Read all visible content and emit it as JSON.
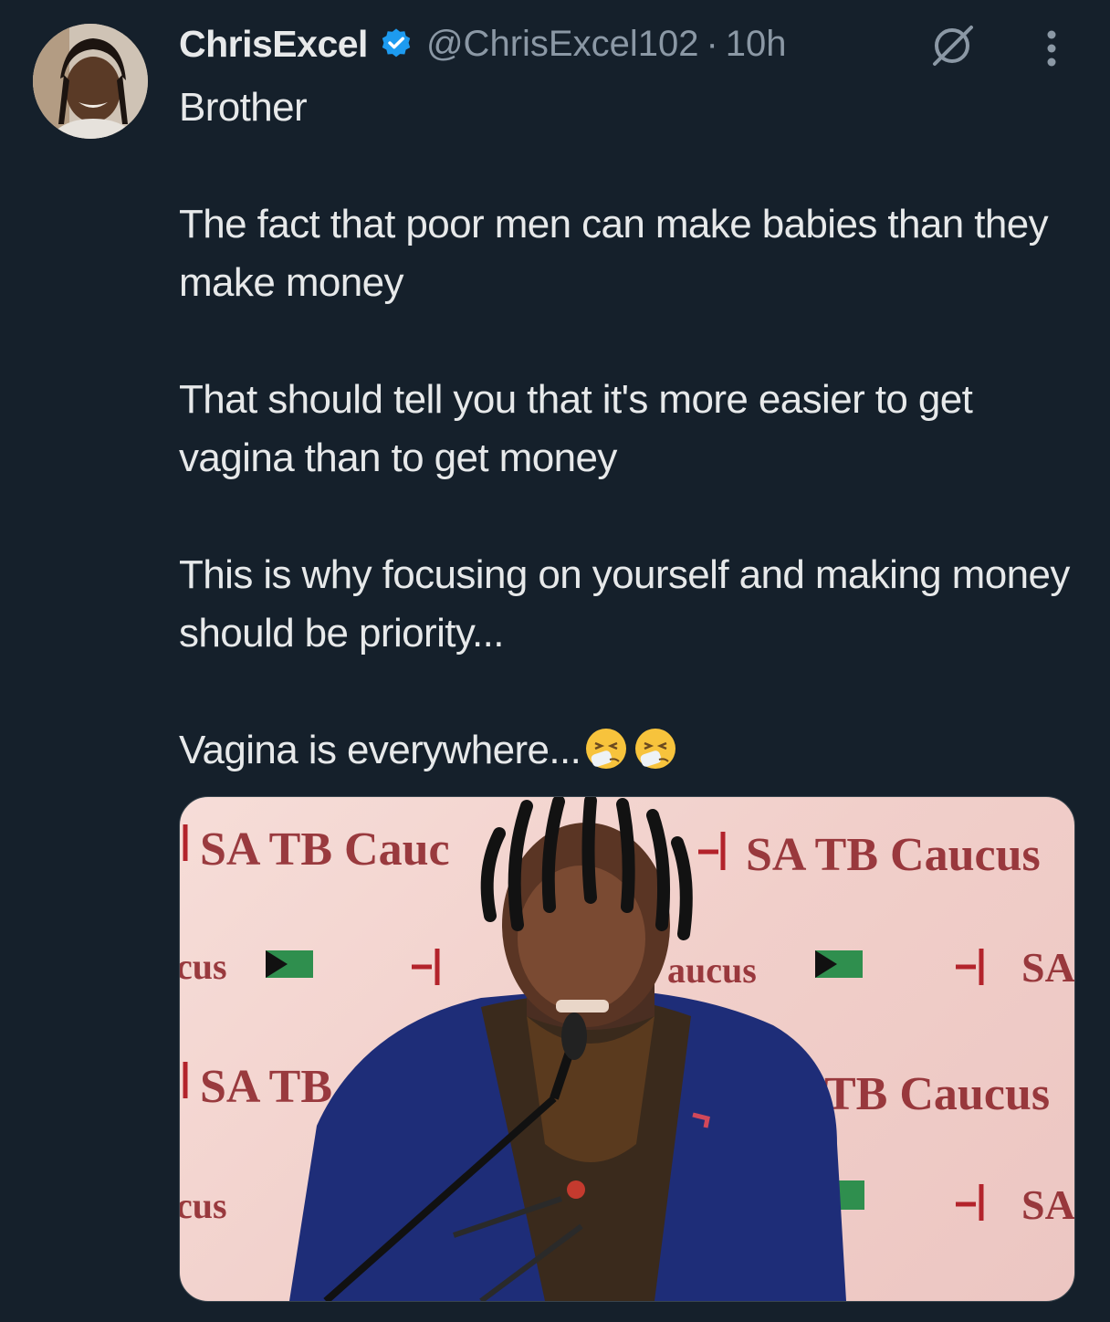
{
  "author": {
    "name": "ChrisExcel",
    "handle": "@ChrisExcel102",
    "separator": "·",
    "time": "10h",
    "avatar_icon": "profile-photo",
    "verified_color": "#1d9bf0"
  },
  "tweet": {
    "paragraphs": [
      "Brother",
      "The fact that poor men can make babies than they make money",
      "That should tell you that it's more easier to get vagina than to get money",
      "This is why focusing on yourself and making money should be priority...",
      "Vagina is everywhere..."
    ],
    "emoji": [
      "sneezing-face-emoji",
      "sneezing-face-emoji"
    ]
  },
  "media": {
    "type": "photo",
    "banner_texts": [
      "SA TB Cauc",
      "SA TB Caucus",
      "cus",
      "aucus",
      "SA",
      "SA TB",
      "TB Caucus",
      "cus",
      "SA"
    ]
  },
  "colors": {
    "background": "#15202b",
    "text": "#e7e9ea",
    "secondary": "#8b98a5",
    "banner_red": "#8a1f25"
  }
}
